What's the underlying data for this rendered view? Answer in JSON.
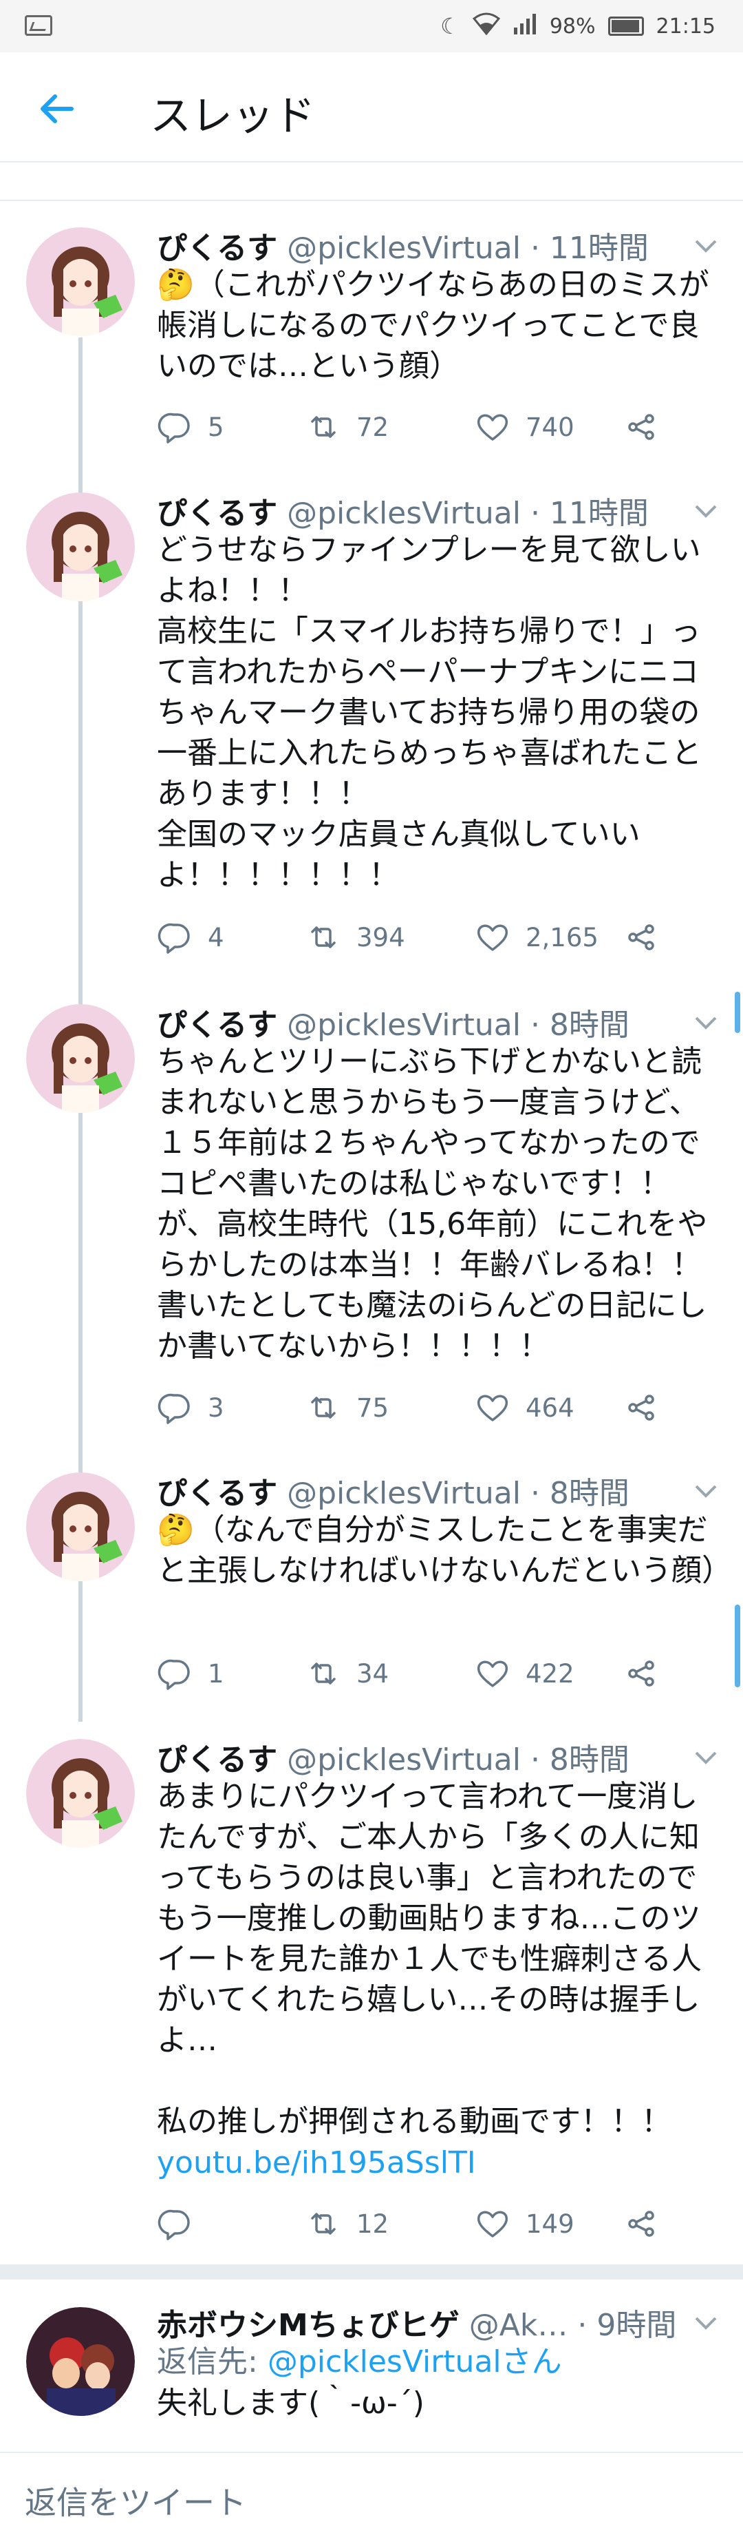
{
  "status_bar": {
    "battery": "98%",
    "time": "21:15"
  },
  "header": {
    "title": "スレッド"
  },
  "thread": [
    {
      "name": "ぴくるす",
      "handle": "@picklesVirtual",
      "time": "· 11時間",
      "text": "🤔（これがパクツイならあの日のミスが帳消しになるのでパクツイってことで良いのでは…という顔）",
      "replies": "5",
      "retweets": "72",
      "likes": "740"
    },
    {
      "name": "ぴくるす",
      "handle": "@picklesVirtual",
      "time": "· 11時間",
      "text": "どうせならファインプレーを見て欲しいよね！！！\n高校生に「スマイルお持ち帰りで！」って言われたからペーパーナプキンにニコちゃんマーク書いてお持ち帰り用の袋の一番上に入れたらめっちゃ喜ばれたことあります！！！\n全国のマック店員さん真似していいよ！！！！！！！",
      "replies": "4",
      "retweets": "394",
      "likes": "2,165"
    },
    {
      "name": "ぴくるす",
      "handle": "@picklesVirtual",
      "time": "· 8時間",
      "text": "ちゃんとツリーにぶら下げとかないと読まれないと思うからもう一度言うけど、１５年前は２ちゃんやってなかったのでコピペ書いたのは私じゃないです！！\nが、高校生時代（15,6年前）にこれをやらかしたのは本当！！年齢バレるね！！\n書いたとしても魔法のiらんどの日記にしか書いてないから！！！！！",
      "replies": "3",
      "retweets": "75",
      "likes": "464"
    },
    {
      "name": "ぴくるす",
      "handle": "@picklesVirtual",
      "time": "· 8時間",
      "text": "🤔（なんで自分がミスしたことを事実だと主張しなければいけないんだという顔）",
      "replies": "1",
      "retweets": "34",
      "likes": "422"
    },
    {
      "name": "ぴくるす",
      "handle": "@picklesVirtual",
      "time": "· 8時間",
      "text": "あまりにパクツイって言われて一度消したんですが、ご本人から「多くの人に知ってもらうのは良い事」と言われたのでもう一度推しの動画貼りますね…このツイートを見た誰か１人でも性癖刺さる人がいてくれたら嬉しい…その時は握手しよ…\n\n私の推しが押倒される動画です！！！",
      "link": "youtu.be/ih195aSslTI",
      "replies": "",
      "retweets": "12",
      "likes": "149"
    }
  ],
  "reply": {
    "name": "赤ボウシMちょびヒゲ",
    "handle": "@Ak…",
    "time": "· 9時間",
    "reply_to_prefix": "返信先: ",
    "reply_to_mention": "@picklesVirtualさん",
    "text": "失礼します(｀-ω-´)"
  },
  "compose": {
    "placeholder": "返信をツイート"
  },
  "colors": {
    "accent": "#1da1f2",
    "secondary_text": "#657786",
    "divider": "#e6ecf0"
  }
}
